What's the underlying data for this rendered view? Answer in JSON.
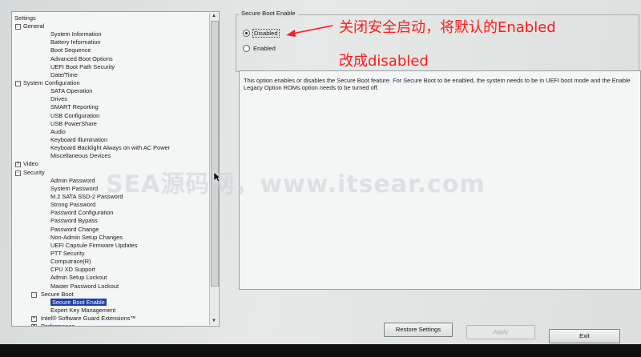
{
  "tree": {
    "title": "Settings",
    "items": [
      {
        "label": "General",
        "level": 0,
        "expander": "-"
      },
      {
        "label": "System Information",
        "level": 2
      },
      {
        "label": "Battery Information",
        "level": 2
      },
      {
        "label": "Boot Sequence",
        "level": 2
      },
      {
        "label": "Advanced Boot Options",
        "level": 2
      },
      {
        "label": "UEFI Boot Path Security",
        "level": 2
      },
      {
        "label": "Date/Time",
        "level": 2
      },
      {
        "label": "System Configuration",
        "level": 0,
        "expander": "-"
      },
      {
        "label": "SATA Operation",
        "level": 2
      },
      {
        "label": "Drives",
        "level": 2
      },
      {
        "label": "SMART Reporting",
        "level": 2
      },
      {
        "label": "USB Configuration",
        "level": 2
      },
      {
        "label": "USB PowerShare",
        "level": 2
      },
      {
        "label": "Audio",
        "level": 2
      },
      {
        "label": "Keyboard Illumination",
        "level": 2
      },
      {
        "label": "Keyboard Backlight Always on with AC Power",
        "level": 2
      },
      {
        "label": "Miscellaneous Devices",
        "level": 2
      },
      {
        "label": "Video",
        "level": 0,
        "expander": "+"
      },
      {
        "label": "Security",
        "level": 0,
        "expander": "-"
      },
      {
        "label": "Admin Password",
        "level": 2
      },
      {
        "label": "System Password",
        "level": 2
      },
      {
        "label": "M.2 SATA SSD-2 Password",
        "level": 2
      },
      {
        "label": "Strong Password",
        "level": 2
      },
      {
        "label": "Password Configuration",
        "level": 2
      },
      {
        "label": "Password Bypass",
        "level": 2
      },
      {
        "label": "Password Change",
        "level": 2
      },
      {
        "label": "Non-Admin Setup Changes",
        "level": 2
      },
      {
        "label": "UEFI Capsule Firmware Updates",
        "level": 2
      },
      {
        "label": "PTT Security",
        "level": 2
      },
      {
        "label": "Computrace(R)",
        "level": 2
      },
      {
        "label": "CPU XD Support",
        "level": 2
      },
      {
        "label": "Admin Setup Lockout",
        "level": 2
      },
      {
        "label": "Master Password Lockout",
        "level": 2
      },
      {
        "label": "Secure Boot",
        "level": 1,
        "expander": "-"
      },
      {
        "label": "Secure Boot Enable",
        "level": 2,
        "selected": true
      },
      {
        "label": "Expert Key Management",
        "level": 2
      },
      {
        "label": "Intel® Software Guard Extensions™",
        "level": 1,
        "expander": "+"
      },
      {
        "label": "Performance",
        "level": 1,
        "expander": "+"
      }
    ]
  },
  "section": {
    "legend": "Secure Boot Enable",
    "options": [
      {
        "label": "Disabled",
        "selected": true
      },
      {
        "label": "Enabled",
        "selected": false
      }
    ],
    "description": "This option enables or disables the Secure Boot feature. For Secure Boot to be enabled, the system needs to be in UEFI boot mode and the Enable Legacy Option ROMs option needs to be turned off."
  },
  "buttons": {
    "restore": "Restore Settings",
    "apply": "Apply",
    "exit": "Exit"
  },
  "annotation": {
    "line1": "关闭安全启动，将默认的Enabled",
    "line2": "改成disabled",
    "color": "#ff1b1b"
  },
  "watermark": "SEA源码网，www.itsear.com",
  "colors": {
    "selection": "#1f3fa8",
    "background": "#e1e4e3"
  }
}
